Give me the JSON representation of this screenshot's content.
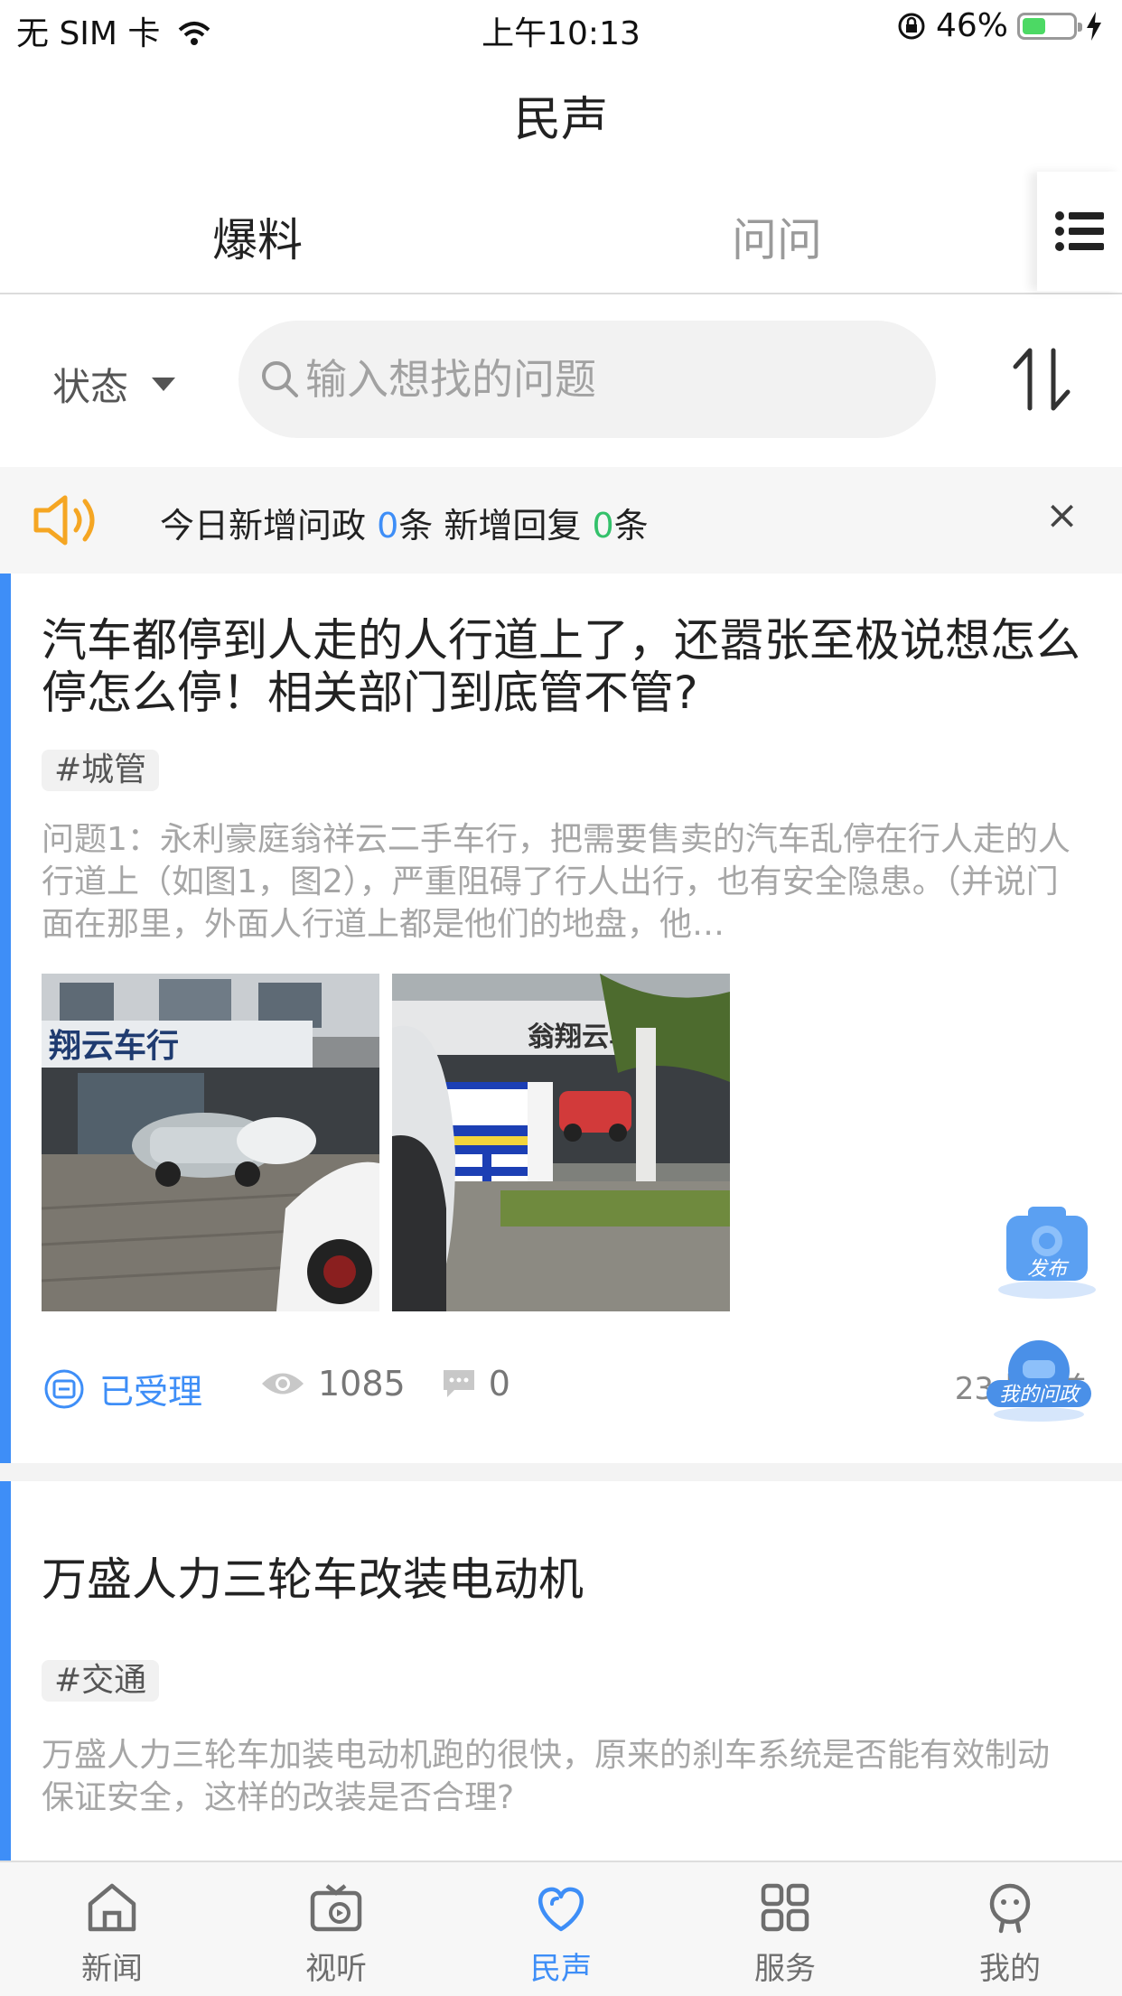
{
  "status_bar": {
    "carrier": "无 SIM 卡",
    "time": "上午10:13",
    "battery": "46%",
    "battery_level": 0.46
  },
  "header": {
    "title": "民声"
  },
  "tabs": [
    {
      "label": "爆料",
      "active": true
    },
    {
      "label": "问问",
      "active": false
    }
  ],
  "menu_icon": "list-icon",
  "filter": {
    "label": "状态"
  },
  "search": {
    "placeholder": "输入想找的问题"
  },
  "notice": {
    "prefix": "今日新增问政 ",
    "count_questions": "0",
    "mid": "条 新增回复 ",
    "count_replies": "0",
    "suffix": "条",
    "close": "×"
  },
  "posts": [
    {
      "title": "汽车都停到人走的人行道上了，还嚣张至极说想怎么停怎么停！相关部门到底管不管?",
      "tag": "#城管",
      "description": "问题1：永利豪庭翁祥云二手车行，把需要售卖的汽车乱停在行人走的人行道上（如图1，图2），严重阻碍了行人出行，也有安全隐患。（并说门面在那里，外面人行道上都是他们的地盘，他…",
      "photo1_sign": "翔云车行",
      "photo2_sign": "翁翔云车行",
      "status": "已受理",
      "views": "1085",
      "comments": "0",
      "time_ago": "23小时前"
    },
    {
      "title": "万盛人力三轮车改装电动机",
      "tag": "#交通",
      "description": "万盛人力三轮车加装电动机跑的很快，原来的刹车系统是否能有效制动保证安全，这样的改装是否合理?"
    }
  ],
  "floating": {
    "publish": "发布",
    "my_questions": "我的问政"
  },
  "tabbar": [
    {
      "label": "新闻",
      "icon": "home-icon"
    },
    {
      "label": "视听",
      "icon": "tv-icon"
    },
    {
      "label": "民声",
      "icon": "heart-icon",
      "active": true
    },
    {
      "label": "服务",
      "icon": "grid-icon"
    },
    {
      "label": "我的",
      "icon": "profile-icon"
    }
  ],
  "colors": {
    "accent": "#3e8ef7",
    "green": "#34c16b",
    "notice_icon": "#f5a623"
  }
}
